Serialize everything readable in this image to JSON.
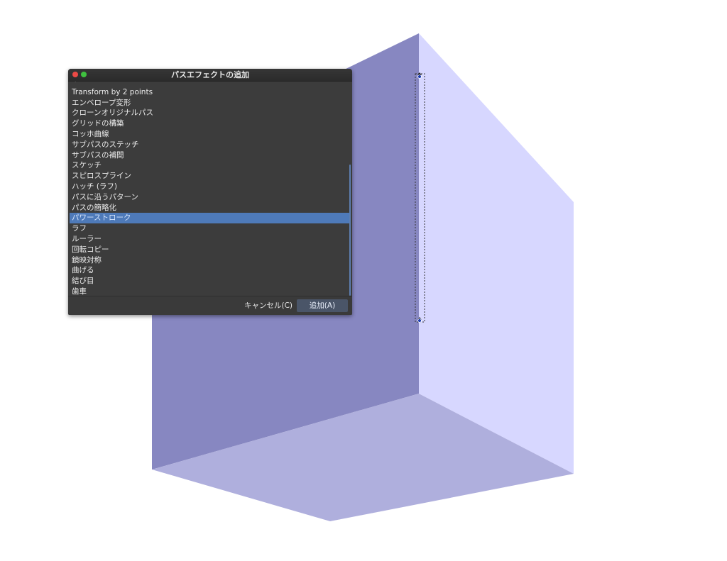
{
  "dialog": {
    "title": "パスエフェクトの追加",
    "items": [
      "・",
      "Transform by 2 points",
      "エンベロープ変形",
      "クローンオリジナルパス",
      "グリッドの構築",
      "コッホ曲線",
      "サブパスのステッチ",
      "サブパスの補間",
      "スケッチ",
      "スピロスプライン",
      "ハッチ (ラフ)",
      "パスに沿うパターン",
      "パスの簡略化",
      "パワーストローク",
      "ラフ",
      "ルーラー",
      "回転コピー",
      "鏡映対称",
      "曲げる",
      "結び目",
      "歯車"
    ],
    "selected_item": "パワーストローク",
    "cancel_label": "キャンセル(C)",
    "add_label": "追加(A)"
  },
  "canvas": {
    "colors": {
      "left_face": "#8787c1",
      "right_face": "#d7d7ff",
      "bottom_face": "#afafdd",
      "selection_outline": "#333333"
    }
  }
}
